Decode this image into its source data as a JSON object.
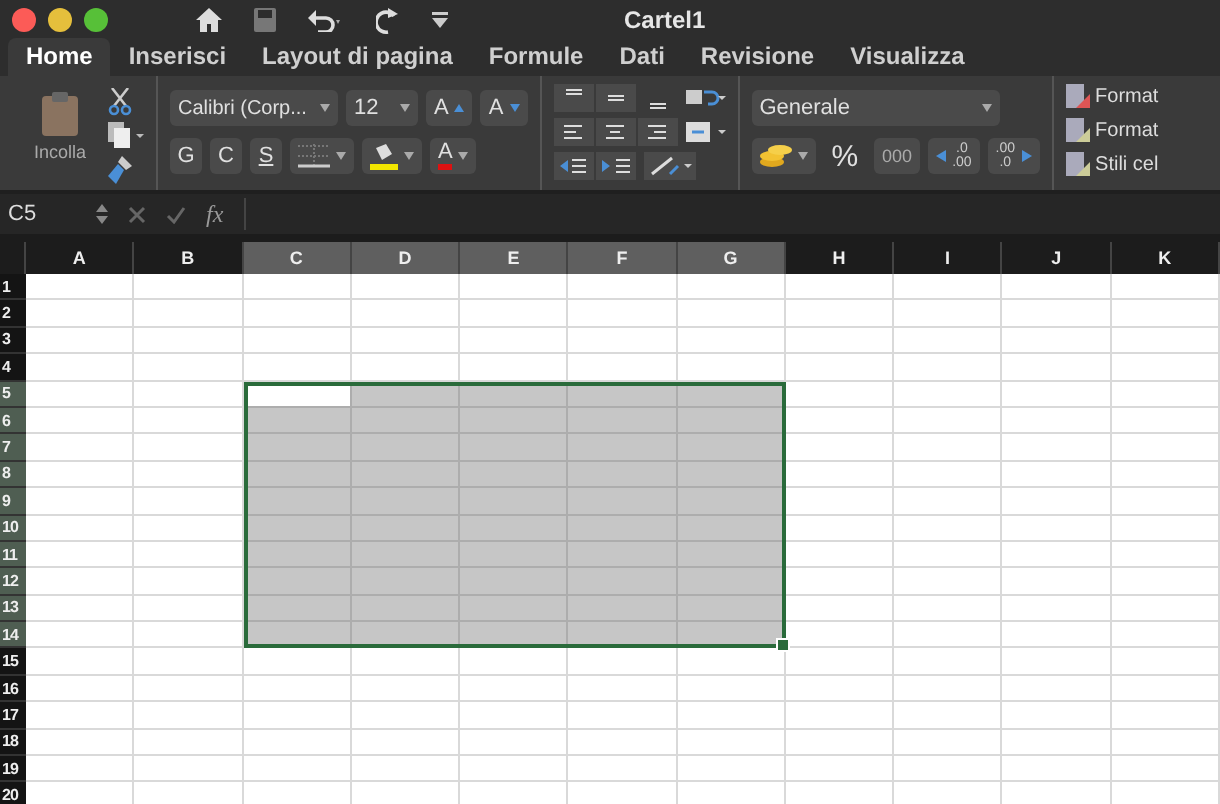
{
  "window": {
    "title": "Cartel1"
  },
  "tabs": [
    {
      "label": "Home",
      "selected": true
    },
    {
      "label": "Inserisci",
      "selected": false
    },
    {
      "label": "Layout di pagina",
      "selected": false
    },
    {
      "label": "Formule",
      "selected": false
    },
    {
      "label": "Dati",
      "selected": false
    },
    {
      "label": "Revisione",
      "selected": false
    },
    {
      "label": "Visualizza",
      "selected": false
    }
  ],
  "ribbon": {
    "paste_label": "Incolla",
    "font_name": "Calibri (Corp...",
    "font_size": "12",
    "grow_font": "A",
    "shrink_font": "A",
    "bold": "G",
    "italic": "C",
    "underline": "S",
    "font_color": "A",
    "number_format": "Generale",
    "percent": "%",
    "thousands": "000",
    "increase_decimal": [
      ".0",
      ".00"
    ],
    "decrease_decimal": [
      ".00",
      ".0"
    ],
    "styles": [
      "Format",
      "Format",
      "Stili cel"
    ]
  },
  "formula_bar": {
    "name_box": "C5",
    "function_label": "fx"
  },
  "sheet": {
    "columns": [
      {
        "label": "A",
        "selected": false
      },
      {
        "label": "B",
        "selected": false
      },
      {
        "label": "C",
        "selected": true
      },
      {
        "label": "D",
        "selected": true
      },
      {
        "label": "E",
        "selected": true
      },
      {
        "label": "F",
        "selected": true
      },
      {
        "label": "G",
        "selected": true
      },
      {
        "label": "H",
        "selected": false
      },
      {
        "label": "I",
        "selected": false
      },
      {
        "label": "J",
        "selected": false
      },
      {
        "label": "K",
        "selected": false
      }
    ],
    "rows": [
      {
        "label": "1",
        "selected": false
      },
      {
        "label": "2",
        "selected": false
      },
      {
        "label": "3",
        "selected": false
      },
      {
        "label": "4",
        "selected": false
      },
      {
        "label": "5",
        "selected": true
      },
      {
        "label": "6",
        "selected": true
      },
      {
        "label": "7",
        "selected": true
      },
      {
        "label": "8",
        "selected": true
      },
      {
        "label": "9",
        "selected": true
      },
      {
        "label": "10",
        "selected": true
      },
      {
        "label": "11",
        "selected": true
      },
      {
        "label": "12",
        "selected": true
      },
      {
        "label": "13",
        "selected": true
      },
      {
        "label": "14",
        "selected": true
      },
      {
        "label": "15",
        "selected": false
      },
      {
        "label": "16",
        "selected": false
      },
      {
        "label": "17",
        "selected": false
      },
      {
        "label": "18",
        "selected": false
      },
      {
        "label": "19",
        "selected": false
      },
      {
        "label": "20",
        "selected": false
      }
    ]
  }
}
